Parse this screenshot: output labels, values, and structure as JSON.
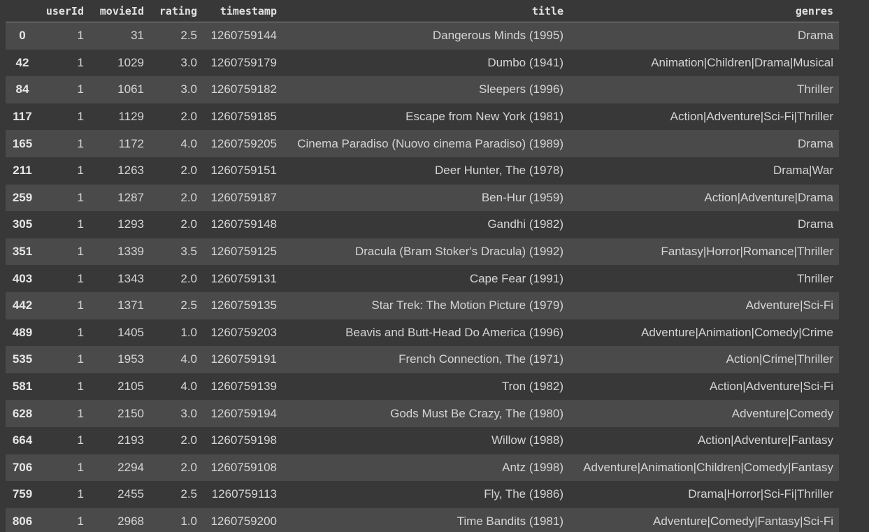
{
  "columns": [
    "userId",
    "movieId",
    "rating",
    "timestamp",
    "title",
    "genres"
  ],
  "rows": [
    {
      "index": "0",
      "userId": "1",
      "movieId": "31",
      "rating": "2.5",
      "timestamp": "1260759144",
      "title": "Dangerous Minds (1995)",
      "genres": "Drama"
    },
    {
      "index": "42",
      "userId": "1",
      "movieId": "1029",
      "rating": "3.0",
      "timestamp": "1260759179",
      "title": "Dumbo (1941)",
      "genres": "Animation|Children|Drama|Musical"
    },
    {
      "index": "84",
      "userId": "1",
      "movieId": "1061",
      "rating": "3.0",
      "timestamp": "1260759182",
      "title": "Sleepers (1996)",
      "genres": "Thriller"
    },
    {
      "index": "117",
      "userId": "1",
      "movieId": "1129",
      "rating": "2.0",
      "timestamp": "1260759185",
      "title": "Escape from New York (1981)",
      "genres": "Action|Adventure|Sci-Fi|Thriller"
    },
    {
      "index": "165",
      "userId": "1",
      "movieId": "1172",
      "rating": "4.0",
      "timestamp": "1260759205",
      "title": "Cinema Paradiso (Nuovo cinema Paradiso) (1989)",
      "genres": "Drama"
    },
    {
      "index": "211",
      "userId": "1",
      "movieId": "1263",
      "rating": "2.0",
      "timestamp": "1260759151",
      "title": "Deer Hunter, The (1978)",
      "genres": "Drama|War"
    },
    {
      "index": "259",
      "userId": "1",
      "movieId": "1287",
      "rating": "2.0",
      "timestamp": "1260759187",
      "title": "Ben-Hur (1959)",
      "genres": "Action|Adventure|Drama"
    },
    {
      "index": "305",
      "userId": "1",
      "movieId": "1293",
      "rating": "2.0",
      "timestamp": "1260759148",
      "title": "Gandhi (1982)",
      "genres": "Drama"
    },
    {
      "index": "351",
      "userId": "1",
      "movieId": "1339",
      "rating": "3.5",
      "timestamp": "1260759125",
      "title": "Dracula (Bram Stoker's Dracula) (1992)",
      "genres": "Fantasy|Horror|Romance|Thriller"
    },
    {
      "index": "403",
      "userId": "1",
      "movieId": "1343",
      "rating": "2.0",
      "timestamp": "1260759131",
      "title": "Cape Fear (1991)",
      "genres": "Thriller"
    },
    {
      "index": "442",
      "userId": "1",
      "movieId": "1371",
      "rating": "2.5",
      "timestamp": "1260759135",
      "title": "Star Trek: The Motion Picture (1979)",
      "genres": "Adventure|Sci-Fi"
    },
    {
      "index": "489",
      "userId": "1",
      "movieId": "1405",
      "rating": "1.0",
      "timestamp": "1260759203",
      "title": "Beavis and Butt-Head Do America (1996)",
      "genres": "Adventure|Animation|Comedy|Crime"
    },
    {
      "index": "535",
      "userId": "1",
      "movieId": "1953",
      "rating": "4.0",
      "timestamp": "1260759191",
      "title": "French Connection, The (1971)",
      "genres": "Action|Crime|Thriller"
    },
    {
      "index": "581",
      "userId": "1",
      "movieId": "2105",
      "rating": "4.0",
      "timestamp": "1260759139",
      "title": "Tron (1982)",
      "genres": "Action|Adventure|Sci-Fi"
    },
    {
      "index": "628",
      "userId": "1",
      "movieId": "2150",
      "rating": "3.0",
      "timestamp": "1260759194",
      "title": "Gods Must Be Crazy, The (1980)",
      "genres": "Adventure|Comedy"
    },
    {
      "index": "664",
      "userId": "1",
      "movieId": "2193",
      "rating": "2.0",
      "timestamp": "1260759198",
      "title": "Willow (1988)",
      "genres": "Action|Adventure|Fantasy"
    },
    {
      "index": "706",
      "userId": "1",
      "movieId": "2294",
      "rating": "2.0",
      "timestamp": "1260759108",
      "title": "Antz (1998)",
      "genres": "Adventure|Animation|Children|Comedy|Fantasy"
    },
    {
      "index": "759",
      "userId": "1",
      "movieId": "2455",
      "rating": "2.5",
      "timestamp": "1260759113",
      "title": "Fly, The (1986)",
      "genres": "Drama|Horror|Sci-Fi|Thriller"
    },
    {
      "index": "806",
      "userId": "1",
      "movieId": "2968",
      "rating": "1.0",
      "timestamp": "1260759200",
      "title": "Time Bandits (1981)",
      "genres": "Adventure|Comedy|Fantasy|Sci-Fi"
    }
  ]
}
